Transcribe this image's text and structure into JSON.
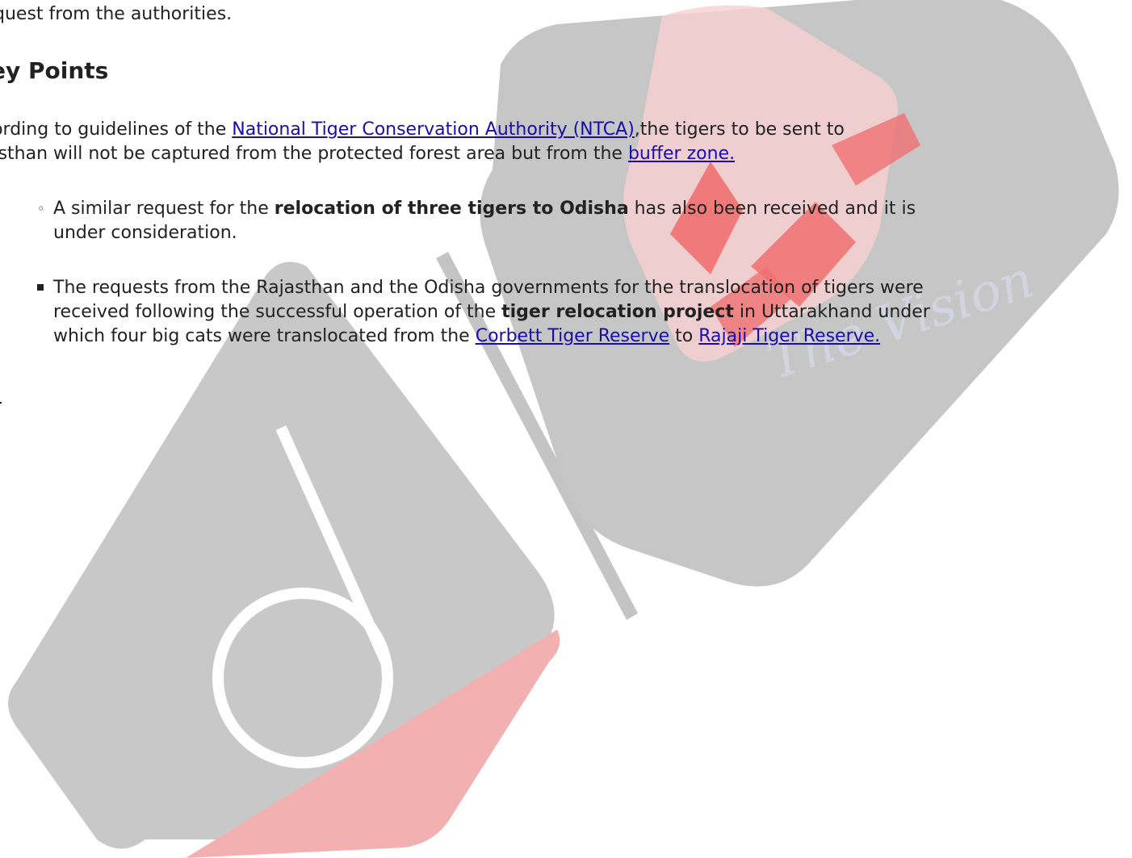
{
  "intro": {
    "text": "quest from the authorities."
  },
  "heading": "ey Points",
  "paragraph": {
    "line1_pre": "cording to guidelines of the ",
    "line1_link": "National Tiger Conservation Authority (NTCA)",
    "line1_post": ",the tigers to be sent to",
    "line2_pre": "jasthan will not be captured from the protected forest area but from the ",
    "line2_link": "buffer zone."
  },
  "sub_item": {
    "bullet": "◦",
    "pre": "A similar request for the ",
    "bold": "relocation of three tigers to Odisha",
    "post": " has also been received and it is",
    "line2": "under consideration."
  },
  "main_item": {
    "line1": "The requests from the Rajasthan and the Odisha governments for the translocation of tigers were",
    "line2_pre": "received following the successful operation of the ",
    "line2_bold": "tiger relocation project",
    "line2_post": " in Uttarakhand under",
    "line3_pre": "which four big cats were translocated from the ",
    "line3_link1": "Corbett Tiger Reserve",
    "line3_mid": " to ",
    "line3_link2": "Rajaji Tiger Reserve."
  },
  "watermark": {
    "logo_text": "The Vision",
    "grey": "#c4c4c4",
    "red": "#f2a8a8",
    "accent_red": "#f07070"
  }
}
